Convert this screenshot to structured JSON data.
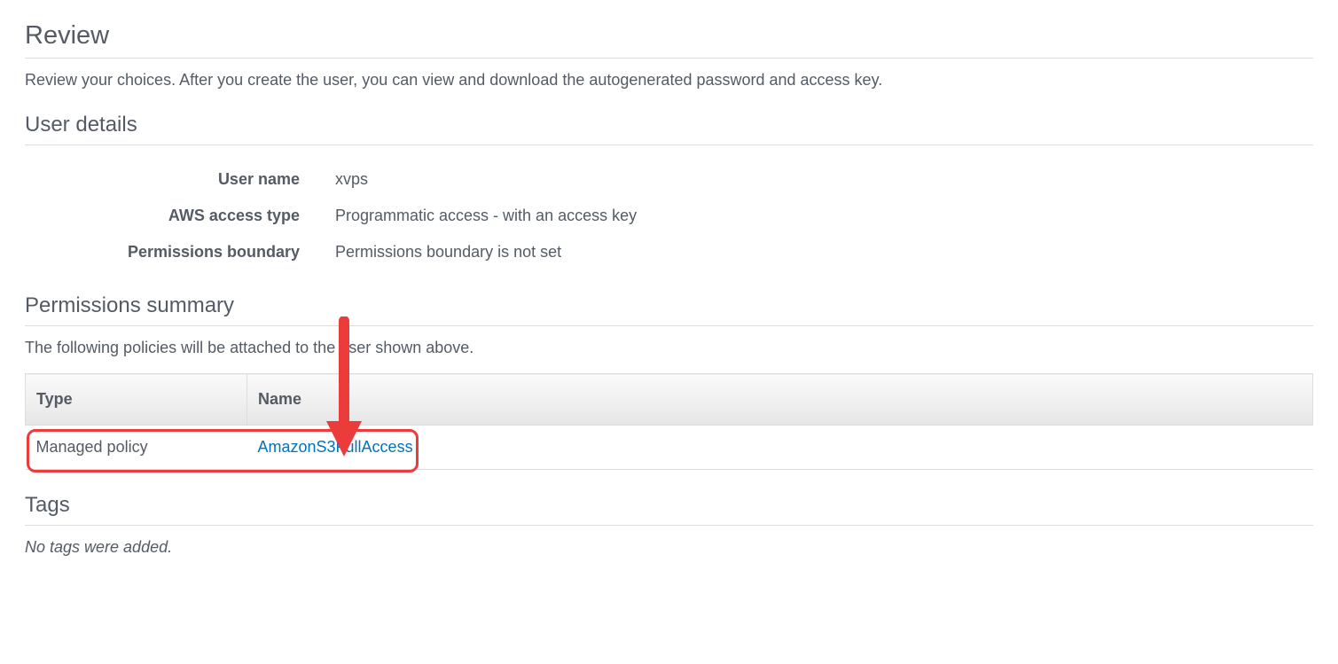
{
  "header": {
    "title": "Review",
    "subtitle": "Review your choices. After you create the user, you can view and download the autogenerated password and access key."
  },
  "user_details": {
    "heading": "User details",
    "rows": [
      {
        "label": "User name",
        "value": "xvps"
      },
      {
        "label": "AWS access type",
        "value": "Programmatic access - with an access key"
      },
      {
        "label": "Permissions boundary",
        "value": "Permissions boundary is not set"
      }
    ]
  },
  "permissions": {
    "heading": "Permissions summary",
    "desc": "The following policies will be attached to the user shown above.",
    "columns": {
      "type": "Type",
      "name": "Name"
    },
    "rows": [
      {
        "type": "Managed policy",
        "name": "AmazonS3FullAccess"
      }
    ]
  },
  "tags": {
    "heading": "Tags",
    "empty": "No tags were added."
  },
  "annotation": {
    "arrow_color": "#ec3b3b"
  }
}
